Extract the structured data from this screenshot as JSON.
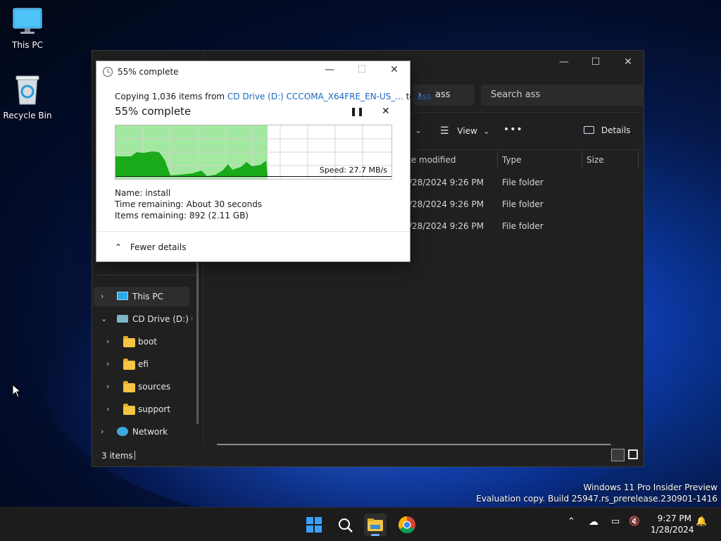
{
  "desktop": {
    "icons": [
      {
        "label": "This PC"
      },
      {
        "label": "Recycle Bin"
      }
    ],
    "watermark": {
      "line1": "Windows 11 Pro Insider Preview",
      "line2": "Evaluation copy. Build 25947.rs_prerelease.230901-1416"
    }
  },
  "explorer": {
    "address_segment": "ass",
    "search_placeholder": "Search ass",
    "toolbar": {
      "view_label": "View",
      "more_label": "•••",
      "details_label": "Details"
    },
    "columns": [
      "te modified",
      "Type",
      "Size"
    ],
    "rows": [
      {
        "modified": "/28/2024 9:26 PM",
        "type": "File folder"
      },
      {
        "modified": "/28/2024 9:26 PM",
        "type": "File folder"
      },
      {
        "modified": "/28/2024 9:26 PM",
        "type": "File folder"
      }
    ],
    "nav": {
      "this_pc": "This PC",
      "cd_drive": "CD Drive (D:) CC",
      "children": [
        "boot",
        "efi",
        "sources",
        "support"
      ],
      "network": "Network"
    },
    "status": "3 items"
  },
  "copy_dialog": {
    "title": "55% complete",
    "copying_prefix": "Copying 1,036 items from",
    "source": "CD Drive (D:) CCCOMA_X64FRE_EN-US_...",
    "to_word": "to",
    "destination": "ass",
    "heading": "55% complete",
    "progress": 0.55,
    "speed": "Speed: 27.7 MB/s",
    "name_line": "Name:  install",
    "time_line": "Time remaining:  About 30 seconds",
    "items_line": "Items remaining:  892 (2.11 GB)",
    "fewer_details": "Fewer details"
  },
  "taskbar": {
    "time": "9:27 PM",
    "date": "1/28/2024"
  }
}
